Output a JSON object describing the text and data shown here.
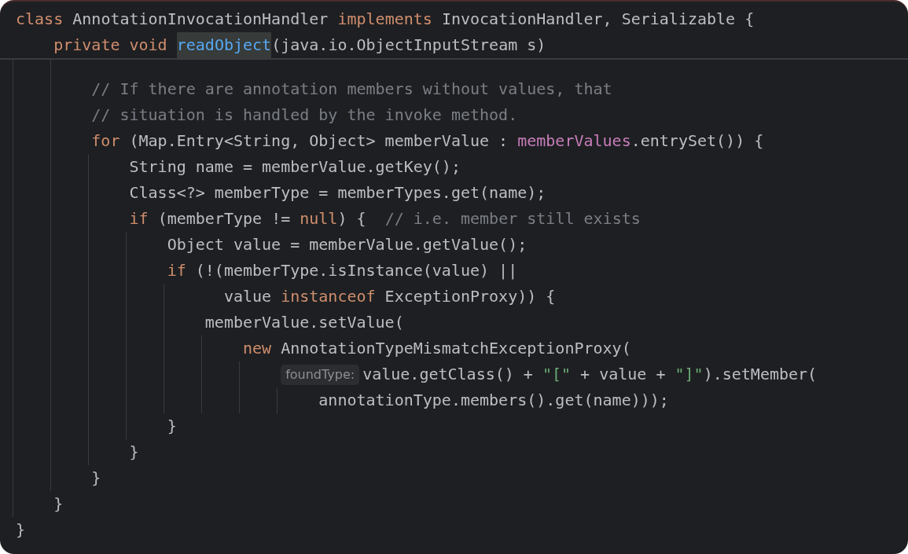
{
  "sticky_lines": [
    {
      "tokens": [
        {
          "kind": "keyword",
          "text": "class"
        },
        {
          "kind": "plain",
          "text": " AnnotationInvocationHandler "
        },
        {
          "kind": "keyword",
          "text": "implements"
        },
        {
          "kind": "plain",
          "text": " InvocationHandler, Serializable {"
        }
      ]
    },
    {
      "tokens": [
        {
          "kind": "keyword",
          "text": "    private void "
        },
        {
          "kind": "method",
          "text": "readObject",
          "highlighted": true
        },
        {
          "kind": "plain",
          "text": "(java.io.ObjectInputStream s)"
        }
      ]
    }
  ],
  "lines": [
    {
      "tokens": [
        {
          "kind": "comment",
          "text": "        // If there are annotation members without values, that"
        }
      ]
    },
    {
      "tokens": [
        {
          "kind": "comment",
          "text": "        // situation is handled by the invoke method."
        }
      ]
    },
    {
      "tokens": [
        {
          "kind": "keyword",
          "text": "        for"
        },
        {
          "kind": "plain",
          "text": " (Map.Entry<String, Object> memberValue : "
        },
        {
          "kind": "field",
          "text": "memberValues"
        },
        {
          "kind": "plain",
          "text": ".entrySet()) {"
        }
      ]
    },
    {
      "tokens": [
        {
          "kind": "plain",
          "text": "            String name = memberValue.getKey();"
        }
      ]
    },
    {
      "tokens": [
        {
          "kind": "plain",
          "text": "            Class<?> memberType = memberTypes.get(name);"
        }
      ]
    },
    {
      "tokens": [
        {
          "kind": "keyword",
          "text": "            if"
        },
        {
          "kind": "plain",
          "text": " (memberType != "
        },
        {
          "kind": "keyword",
          "text": "null"
        },
        {
          "kind": "plain",
          "text": ") {  "
        },
        {
          "kind": "comment",
          "text": "// i.e. member still exists"
        }
      ]
    },
    {
      "tokens": [
        {
          "kind": "plain",
          "text": "                Object value = memberValue.getValue();"
        }
      ]
    },
    {
      "tokens": [
        {
          "kind": "keyword",
          "text": "                if"
        },
        {
          "kind": "plain",
          "text": " (!(memberType.isInstance(value) ||"
        }
      ]
    },
    {
      "tokens": [
        {
          "kind": "plain",
          "text": "                      value "
        },
        {
          "kind": "keyword",
          "text": "instanceof"
        },
        {
          "kind": "plain",
          "text": " ExceptionProxy)) {"
        }
      ]
    },
    {
      "tokens": [
        {
          "kind": "plain",
          "text": "                    memberValue.setValue("
        }
      ]
    },
    {
      "tokens": [
        {
          "kind": "keyword",
          "text": "                        new"
        },
        {
          "kind": "plain",
          "text": " AnnotationTypeMismatchExceptionProxy("
        }
      ]
    },
    {
      "tokens": [
        {
          "kind": "hint",
          "text": "                            foundType:"
        },
        {
          "kind": "plain",
          "text": "value.getClass() + "
        },
        {
          "kind": "string",
          "text": "\"[\""
        },
        {
          "kind": "plain",
          "text": " + value + "
        },
        {
          "kind": "string",
          "text": "\"]\""
        },
        {
          "kind": "plain",
          "text": ").setMember("
        }
      ]
    },
    {
      "tokens": [
        {
          "kind": "plain",
          "text": "                                annotationType.members().get(name)));"
        }
      ]
    },
    {
      "tokens": [
        {
          "kind": "plain",
          "text": "                }"
        }
      ]
    },
    {
      "tokens": [
        {
          "kind": "plain",
          "text": "            }"
        }
      ]
    },
    {
      "tokens": [
        {
          "kind": "plain",
          "text": "        }"
        }
      ]
    },
    {
      "tokens": [
        {
          "kind": "plain",
          "text": "    }"
        }
      ]
    },
    {
      "tokens": [
        {
          "kind": "plain",
          "text": "}"
        }
      ]
    }
  ]
}
